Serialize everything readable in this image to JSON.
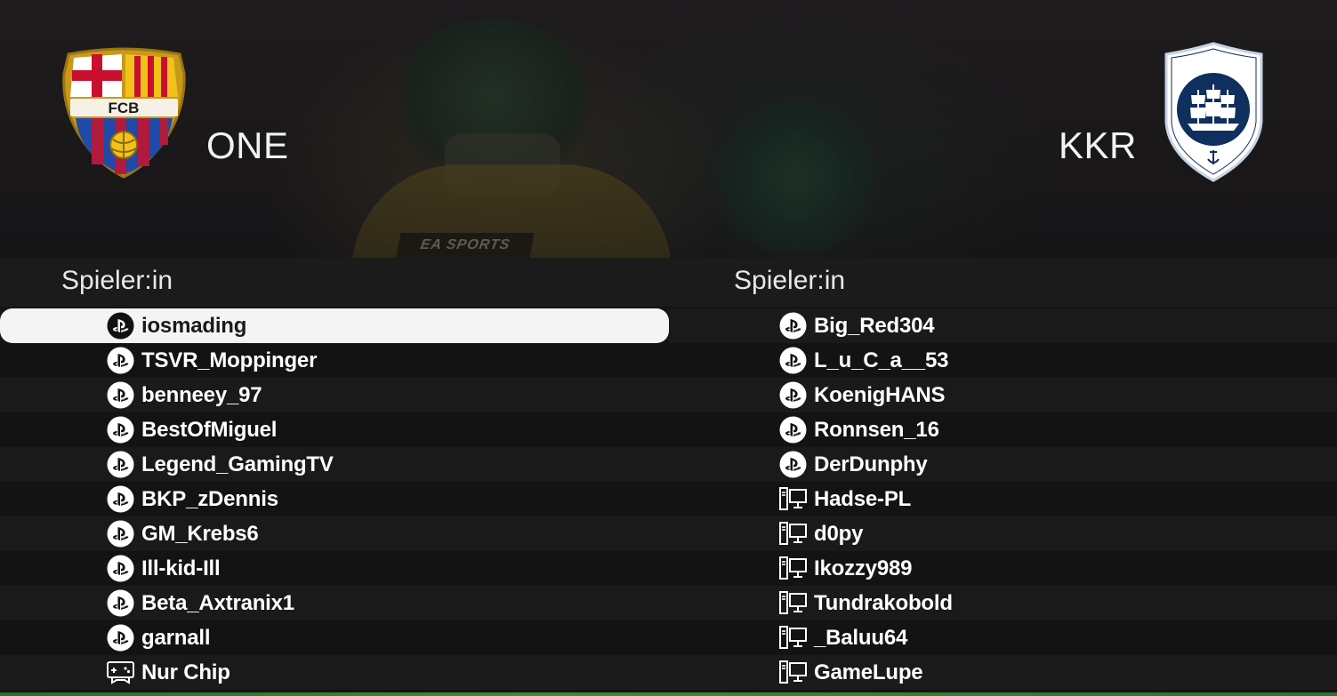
{
  "teams": {
    "home": {
      "name": "ONE",
      "crest_icon": "fc-barcelona-crest-icon"
    },
    "away": {
      "name": "KKR",
      "crest_icon": "ship-shield-crest-icon"
    }
  },
  "background_text": "EA SPORTS",
  "home_crest_text": "FCB",
  "left": {
    "header": "Spieler:in",
    "players": [
      {
        "name": "iosmading",
        "platform": "playstation-icon",
        "selected": true
      },
      {
        "name": "TSVR_Moppinger",
        "platform": "playstation-icon"
      },
      {
        "name": "benneey_97",
        "platform": "playstation-icon"
      },
      {
        "name": "BestOfMiguel",
        "platform": "playstation-icon"
      },
      {
        "name": "Legend_GamingTV",
        "platform": "playstation-icon"
      },
      {
        "name": "BKP_zDennis",
        "platform": "playstation-icon"
      },
      {
        "name": "GM_Krebs6",
        "platform": "playstation-icon"
      },
      {
        "name": "Ill-kid-Ill",
        "platform": "playstation-icon"
      },
      {
        "name": "Beta_Axtranix1",
        "platform": "playstation-icon"
      },
      {
        "name": "garnall",
        "platform": "playstation-icon"
      },
      {
        "name": "Nur Chip",
        "platform": "gamepad-icon"
      }
    ]
  },
  "right": {
    "header": "Spieler:in",
    "players": [
      {
        "name": "Big_Red304",
        "platform": "playstation-icon"
      },
      {
        "name": "L_u_C_a__53",
        "platform": "playstation-icon"
      },
      {
        "name": "KoenigHANS",
        "platform": "playstation-icon"
      },
      {
        "name": "Ronnsen_16",
        "platform": "playstation-icon"
      },
      {
        "name": "DerDunphy",
        "platform": "playstation-icon"
      },
      {
        "name": "Hadse-PL",
        "platform": "pc-icon"
      },
      {
        "name": "d0py",
        "platform": "pc-icon"
      },
      {
        "name": "Ikozzy989",
        "platform": "pc-icon"
      },
      {
        "name": "Tundrakobold",
        "platform": "pc-icon"
      },
      {
        "name": "_Baluu64",
        "platform": "pc-icon"
      },
      {
        "name": "GameLupe",
        "platform": "pc-icon"
      }
    ]
  },
  "colors": {
    "selected_row": "#f4f4f4",
    "row_alt": "#1a1a1a",
    "row_base": "#131313",
    "barca_blue": "#1f4aa8",
    "barca_red": "#b01a3c",
    "barca_gold": "#f2c21b",
    "kkr_navy": "#0f2f5e"
  }
}
